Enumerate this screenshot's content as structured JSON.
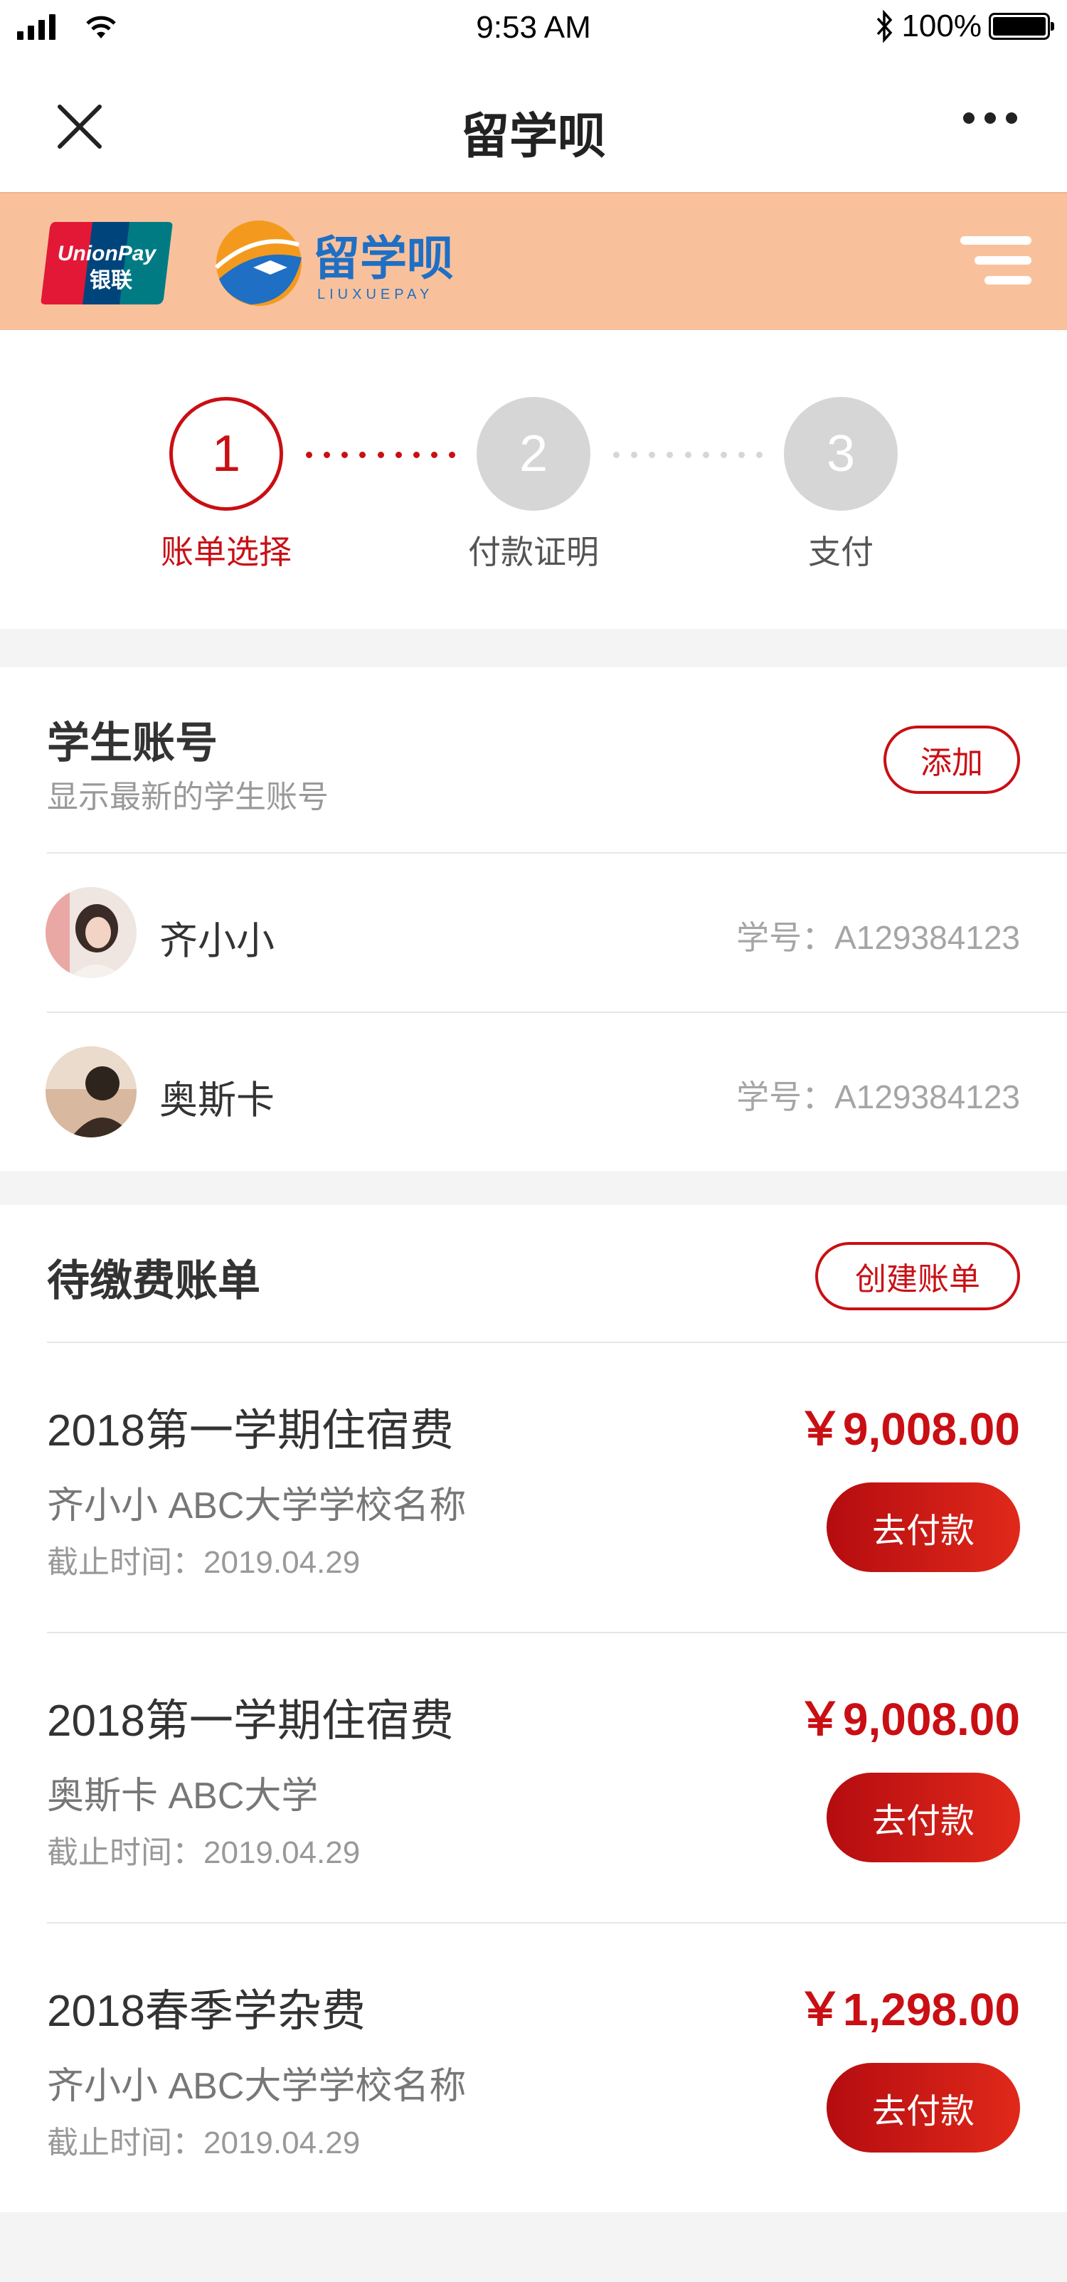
{
  "status_bar": {
    "time": "9:53 AM",
    "battery": "100%"
  },
  "navbar": {
    "title": "留学呗"
  },
  "brand": {
    "unionpay_en": "UnionPay",
    "unionpay_cn": "银联",
    "logo_cn": "留学呗",
    "logo_en": "LIUXUEPAY"
  },
  "steps": [
    {
      "number": "1",
      "label": "账单选择",
      "state": "active"
    },
    {
      "number": "2",
      "label": "付款证明",
      "state": "pending"
    },
    {
      "number": "3",
      "label": "支付",
      "state": "pending"
    }
  ],
  "students_section": {
    "title": "学生账号",
    "subtitle": "显示最新的学生账号",
    "add_label": "添加",
    "items": [
      {
        "name": "齐小小",
        "id_label": "学号：A129384123"
      },
      {
        "name": "奥斯卡",
        "id_label": "学号：A129384123"
      }
    ]
  },
  "bills_section": {
    "title": "待缴费账单",
    "create_label": "创建账单",
    "items": [
      {
        "title": "2018第一学期住宿费",
        "info": "齐小小 ABC大学学校名称",
        "due": "截止时间：2019.04.29",
        "amount": "￥9,008.00",
        "pay_label": "去付款"
      },
      {
        "title": "2018第一学期住宿费",
        "info": "奥斯卡 ABC大学",
        "due": "截止时间：2019.04.29",
        "amount": "￥9,008.00",
        "pay_label": "去付款"
      },
      {
        "title": "2018春季学杂费",
        "info": "齐小小 ABC大学学校名称",
        "due": "截止时间：2019.04.29",
        "amount": "￥1,298.00",
        "pay_label": "去付款"
      }
    ]
  },
  "colors": {
    "accent": "#c90f14",
    "brand_bar": "#f8c19c",
    "step_pending": "#d6d6d6"
  }
}
